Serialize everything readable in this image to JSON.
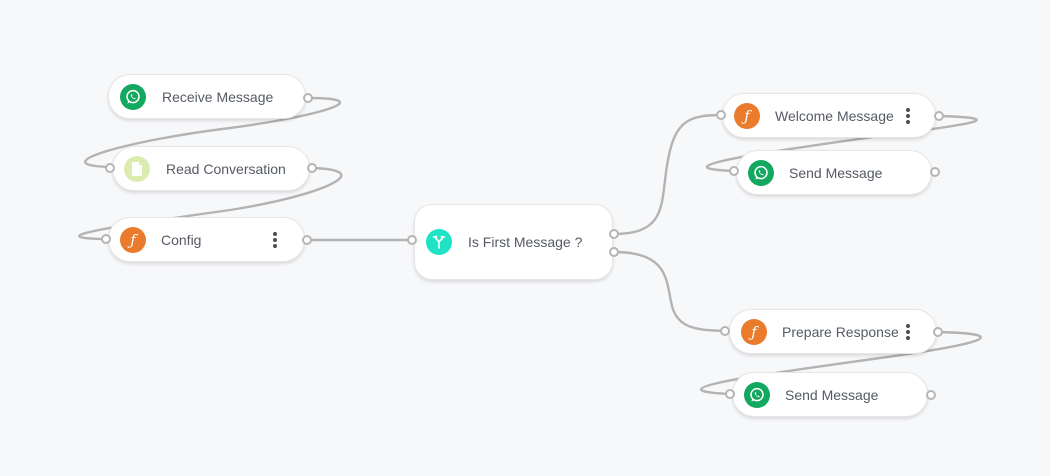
{
  "flow": {
    "nodes": [
      {
        "id": "receive",
        "label": "Receive Message",
        "icon": "whatsapp-icon",
        "menu": false
      },
      {
        "id": "read",
        "label": "Read Conversation",
        "icon": "document-icon",
        "menu": false
      },
      {
        "id": "config",
        "label": "Config",
        "icon": "function-icon",
        "menu": true
      },
      {
        "id": "condition",
        "label": "Is First Message ?",
        "icon": "branch-icon",
        "menu": false
      },
      {
        "id": "welcome",
        "label": "Welcome Message",
        "icon": "function-icon",
        "menu": true
      },
      {
        "id": "send1",
        "label": "Send Message",
        "icon": "whatsapp-icon",
        "menu": false
      },
      {
        "id": "prepare",
        "label": "Prepare Response",
        "icon": "function-icon",
        "menu": true
      },
      {
        "id": "send2",
        "label": "Send Message",
        "icon": "whatsapp-icon",
        "menu": false
      }
    ],
    "function_glyph": "ƒ",
    "colors": {
      "whatsapp": "#13a85f",
      "document": "#dcecb1",
      "function": "#ea7a2c",
      "condition": "#1ee3c4",
      "edge": "#b3b3b3",
      "background": "#f7f8fa"
    }
  }
}
